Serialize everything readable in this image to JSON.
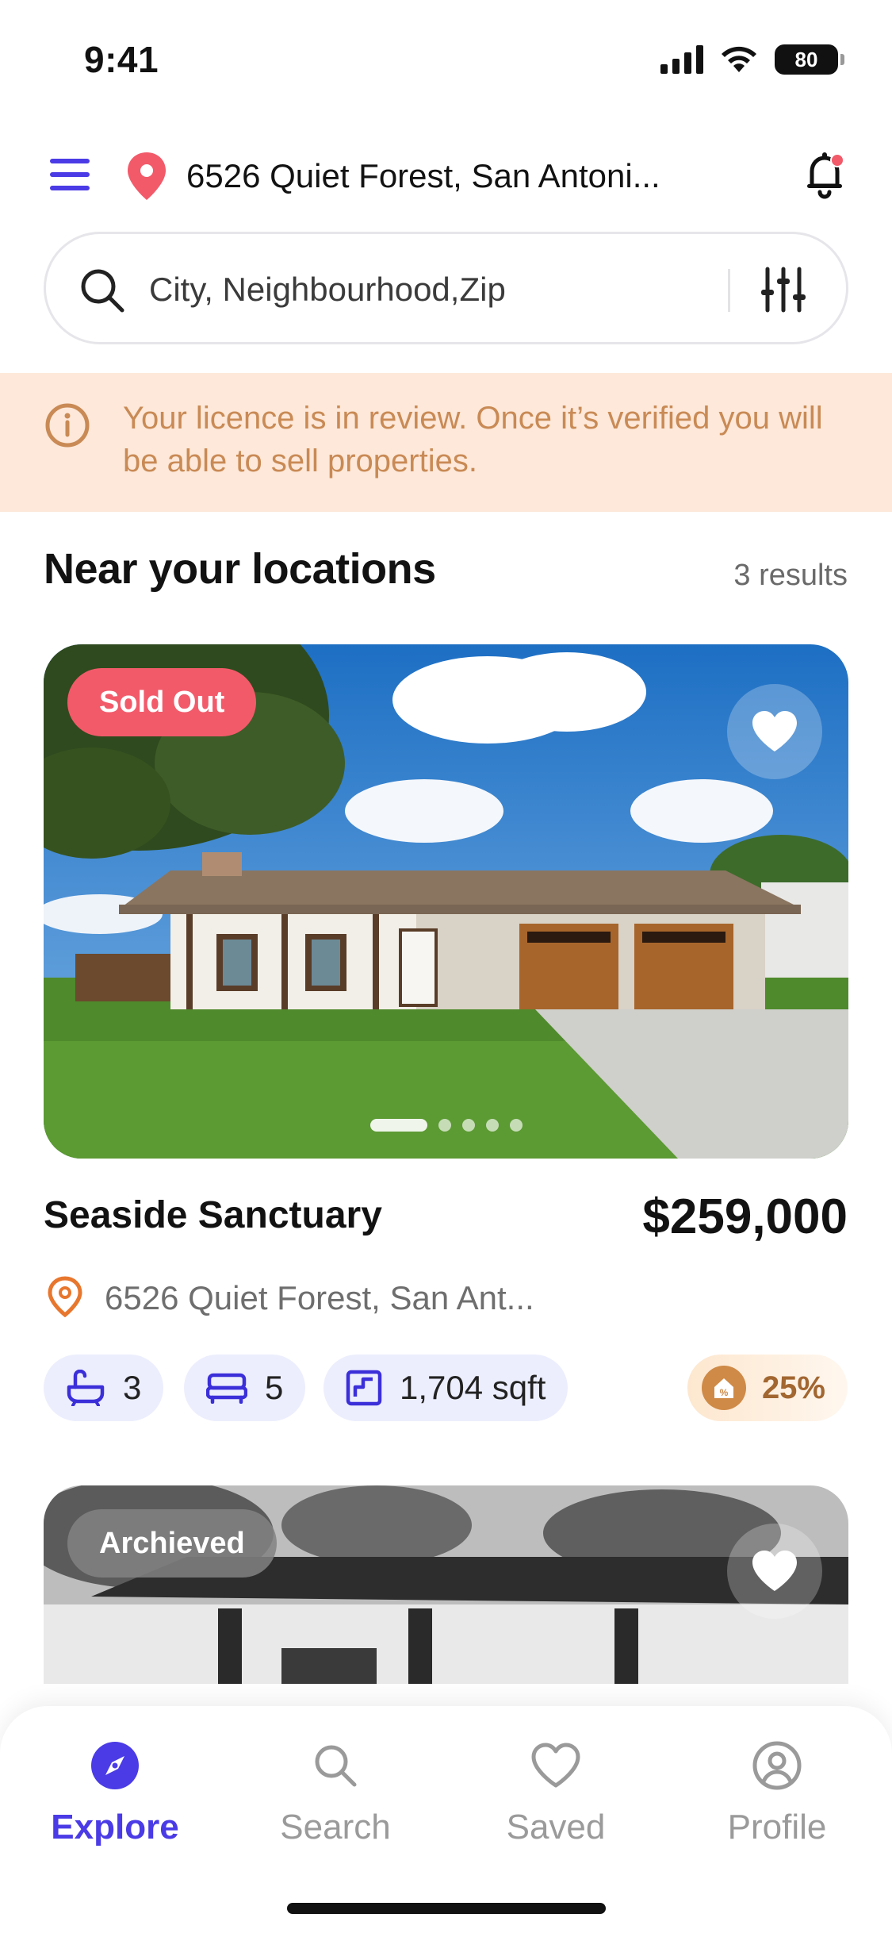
{
  "status_bar": {
    "time": "9:41",
    "battery": "80"
  },
  "header": {
    "location": "6526 Quiet Forest, San Antoni...",
    "icons": [
      "menu-icon",
      "map-pin-icon",
      "bell-icon"
    ]
  },
  "search": {
    "placeholder": "City, Neighbourhood,Zip",
    "value": ""
  },
  "banner": {
    "message": "Your licence is in review.  Once it’s verified you will be able to sell properties."
  },
  "section": {
    "title": "Near your locations",
    "count": "3 results"
  },
  "listings": [
    {
      "badge": "Sold Out",
      "title": "Seaside Sanctuary",
      "price": "$259,000",
      "address": "6526 Quiet Forest, San Ant...",
      "baths": "3",
      "beds": "5",
      "area": "1,704 sqft",
      "commission": "25%",
      "image_count": 5,
      "active_image": 1
    },
    {
      "badge": "Archieved"
    }
  ],
  "nav": {
    "explore": "Explore",
    "search": "Search",
    "saved": "Saved",
    "profile": "Profile"
  },
  "colors": {
    "accent": "#4a3be6",
    "sold_badge": "#f25a6a",
    "banner_bg": "#fde8d9",
    "banner_text": "#c98a55",
    "chip_bg": "#eceefd"
  }
}
